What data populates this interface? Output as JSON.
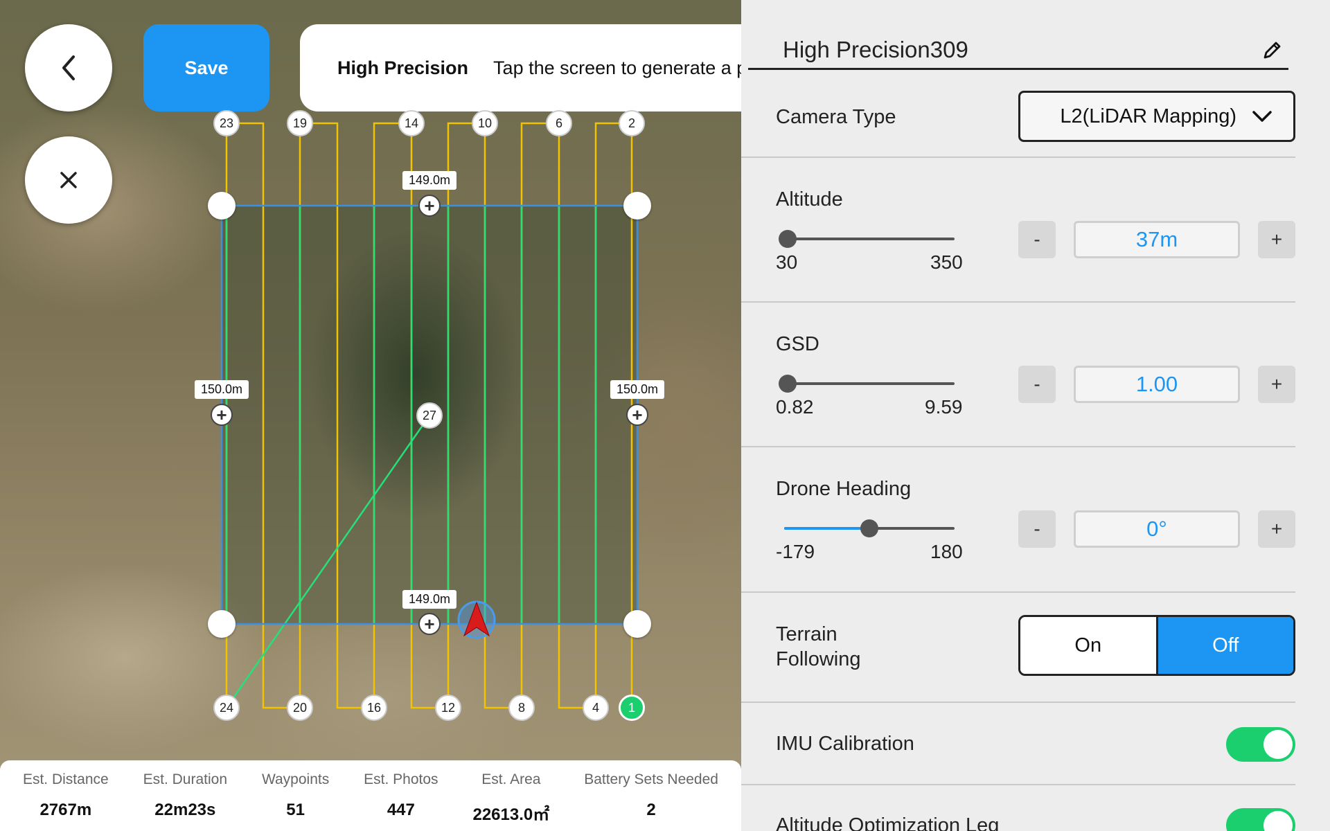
{
  "header": {
    "save_label": "Save",
    "mode_label": "High Precision",
    "hint": "Tap the screen to generate a po"
  },
  "map": {
    "edge_labels": {
      "top": "149.0m",
      "bottom": "149.0m",
      "left": "150.0m",
      "right": "150.0m"
    },
    "waypoints_top": [
      "23",
      "19",
      "14",
      "10",
      "6",
      "2"
    ],
    "waypoints_bottom": [
      "24",
      "20",
      "16",
      "12",
      "8",
      "4",
      "1"
    ],
    "waypoint_center": "27",
    "colors": {
      "flight_line": "#f2c400",
      "mapping_line": "#26e07a",
      "boundary": "#3d8fe0"
    }
  },
  "stats": [
    {
      "key": "Est. Distance",
      "value": "2767m"
    },
    {
      "key": "Est. Duration",
      "value": "22m23s"
    },
    {
      "key": "Waypoints",
      "value": "51"
    },
    {
      "key": "Est. Photos",
      "value": "447"
    },
    {
      "key": "Est. Area",
      "value": "22613.0㎡"
    },
    {
      "key": "Battery Sets Needed",
      "value": "2"
    }
  ],
  "panel": {
    "mission_name": "High Precision309",
    "camera_type_label": "Camera Type",
    "camera_type_value": "L2(LiDAR Mapping)",
    "altitude": {
      "label": "Altitude",
      "min": "30",
      "max": "350",
      "value": "37m",
      "level": 0.02
    },
    "gsd": {
      "label": "GSD",
      "min": "0.82",
      "max": "9.59",
      "value": "1.00",
      "level": 0.02
    },
    "heading": {
      "label": "Drone Heading",
      "min": "-179",
      "max": "180",
      "value": "0°",
      "level": 0.5
    },
    "terrain": {
      "label_line1": "Terrain",
      "label_line2": "Following",
      "on": "On",
      "off": "Off",
      "selected": "Off"
    },
    "imu_label": "IMU Calibration",
    "imu_enabled": true,
    "alt_opt_label": "Altitude Optimization Leg",
    "alt_opt_enabled": true,
    "minus": "-",
    "plus": "+"
  },
  "accent_color": "#1d96f3"
}
